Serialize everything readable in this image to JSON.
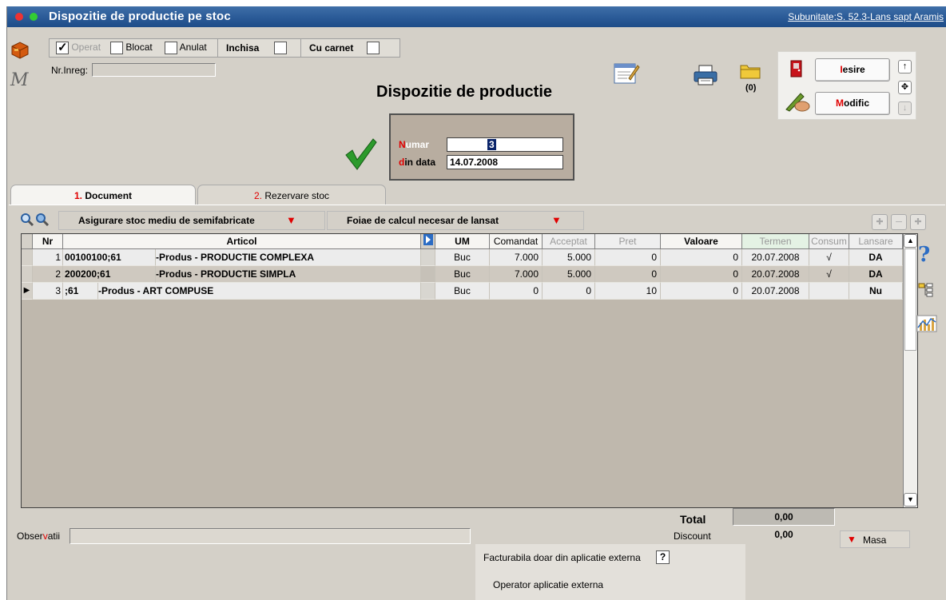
{
  "window": {
    "title": "Dispozitie de productie pe stoc",
    "subunitate": "Subunitate:S. 52.3-Lans sapt Aramis"
  },
  "flags": {
    "operat": "Operat",
    "blocat": "Blocat",
    "anulat": "Anulat",
    "inchisa": "Inchisa",
    "cu_carnet": "Cu carnet",
    "operat_checked": true
  },
  "nr_inreg_label": "Nr.Inreg:",
  "nr_inreg_value": "",
  "logo_letter": "M",
  "form_title": "Dispozitie de productie",
  "attachments_count": "(0)",
  "buttons": {
    "iesire_first": "I",
    "iesire_rest": "esire",
    "modific_first": "M",
    "modific_rest": "odific"
  },
  "document": {
    "numar_first": "N",
    "numar_rest": "umar",
    "numar_value": "3",
    "data_first": "d",
    "data_rest": "in data",
    "data_value": "14.07.2008"
  },
  "tabs": [
    {
      "num": "1.",
      "label": "Document"
    },
    {
      "num": "2.",
      "label": "Rezervare stoc"
    }
  ],
  "toolbar": {
    "asigurare": "Asigurare stoc mediu de semifabricate",
    "foaie": "Foiae de calcul necesar de lansat"
  },
  "table": {
    "columns": [
      "Nr",
      "Articol",
      "UM",
      "Comandat",
      "Acceptat",
      "Pret",
      "Valoare",
      "Termen",
      "Consum",
      "Lansare"
    ],
    "rows": [
      {
        "nr": "1",
        "cod": "00100100;61",
        "articol": "-Produs  - PRODUCTIE COMPLEXA",
        "um": "Buc",
        "comandat": "7.000",
        "acceptat": "5.000",
        "pret": "0",
        "valoare": "0",
        "termen": "20.07.2008",
        "consum": "√",
        "lansare": "DA"
      },
      {
        "nr": "2",
        "cod": "200200;61",
        "articol": "-Produs  - PRODUCTIE SIMPLA",
        "um": "Buc",
        "comandat": "7.000",
        "acceptat": "5.000",
        "pret": "0",
        "valoare": "0",
        "termen": "20.07.2008",
        "consum": "√",
        "lansare": "DA"
      },
      {
        "nr": "3",
        "cod": ";61",
        "articol": "-Produs  - ART COMPUSE",
        "um": "Buc",
        "comandat": "0",
        "acceptat": "0",
        "pret": "10",
        "valoare": "0",
        "termen": "20.07.2008",
        "consum": "",
        "lansare": "Nu"
      }
    ]
  },
  "totals": {
    "total_label": "Total",
    "total_value": "0,00",
    "discount_label": "Discount",
    "discount_value": "0,00",
    "masa": "Masa"
  },
  "observatii": {
    "label_a": "Obser",
    "label_b": "v",
    "label_c": "atii",
    "value": ""
  },
  "external": {
    "facturabila": "Facturabila doar din aplicatie externa",
    "help_mark": "?",
    "operator": "Operator aplicatie externa"
  },
  "colors": {
    "titlebar": "#2a5a97",
    "panel": "#d4d0c8",
    "grid_bg": "#bfb8ad",
    "accent_red": "#e00000"
  }
}
